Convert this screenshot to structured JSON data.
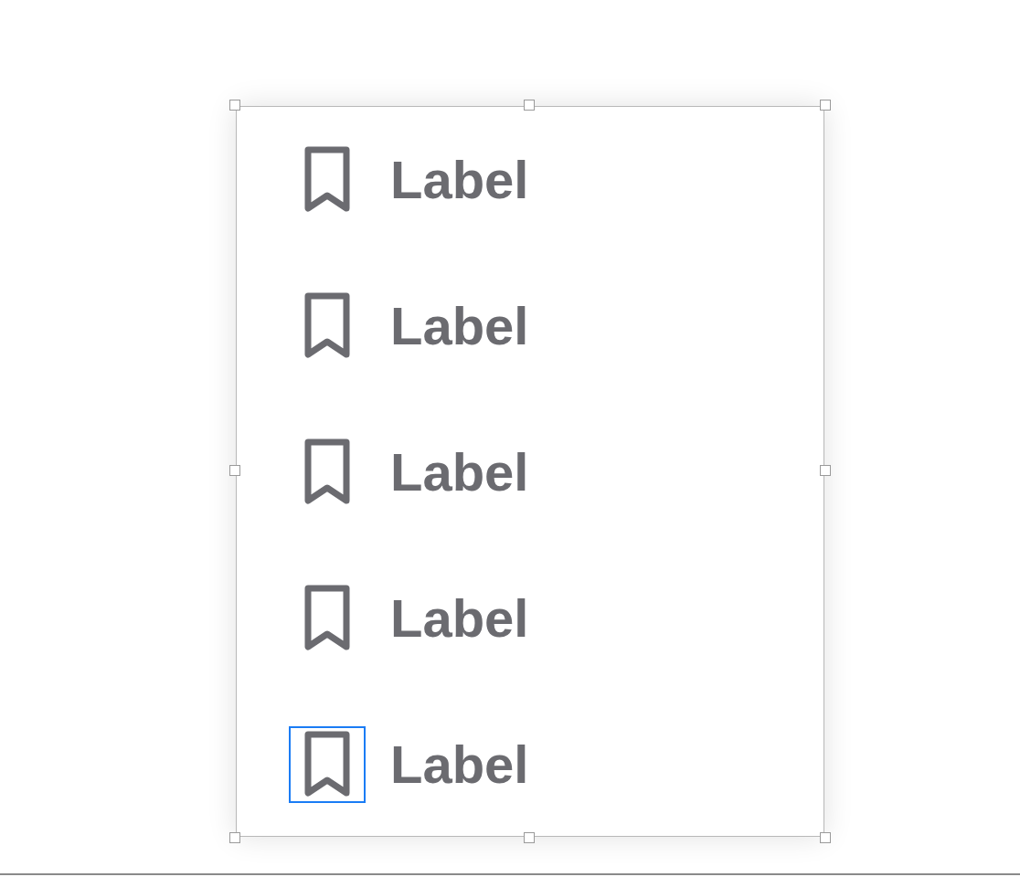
{
  "items": [
    {
      "label": "Label",
      "selected": false
    },
    {
      "label": "Label",
      "selected": false
    },
    {
      "label": "Label",
      "selected": false
    },
    {
      "label": "Label",
      "selected": false
    },
    {
      "label": "Label",
      "selected": true
    }
  ]
}
